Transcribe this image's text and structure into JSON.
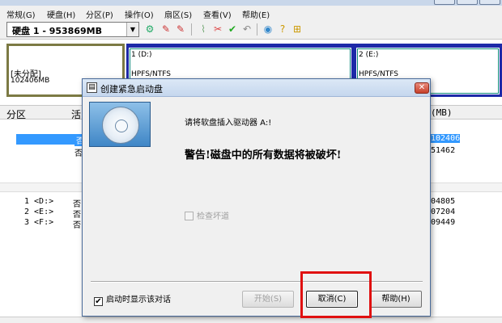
{
  "menu": [
    "常规(G)",
    "硬盘(H)",
    "分区(P)",
    "操作(O)",
    "扇区(S)",
    "查看(V)",
    "帮助(E)"
  ],
  "toolbar": {
    "disk_selected": "硬盘 1 - 953869MB"
  },
  "diskmap": {
    "unallocated": {
      "label": "[未分配]",
      "size": "102406MB"
    },
    "partitions": [
      {
        "name": "1 (D:)",
        "fs": "HPFS/NTFS"
      },
      {
        "name": "2 (E:)",
        "fs": "HPFS/NTFS"
      }
    ]
  },
  "list": {
    "col_partition": "分区",
    "col_active": "活",
    "col_size": "(MB)",
    "rows_top": [
      {
        "active": "否",
        "size": "102406",
        "selected": true
      },
      {
        "active": "否",
        "size": "51462",
        "selected": false
      }
    ],
    "rows_bottom": [
      {
        "name": "1 <D:>",
        "active": "否",
        "size": "04805"
      },
      {
        "name": "2 <E:>",
        "active": "否",
        "size": "07204"
      },
      {
        "name": "3 <F:>",
        "active": "否",
        "size": "09449"
      }
    ]
  },
  "dialog": {
    "title": "创建紧急启动盘",
    "close_glyph": "✕",
    "message": "请将软盘插入驱动器 A:!",
    "warning": "警告!磁盘中的所有数据将被破坏!",
    "check_bad_sectors": "检查坏道",
    "show_on_start": "启动时显示该对话",
    "btn_start": "开始(S)",
    "btn_cancel": "取消(C)",
    "btn_help": "帮助(H)"
  },
  "colors": {
    "highlight": "#3399ff",
    "annotation_box": "#e01010"
  }
}
